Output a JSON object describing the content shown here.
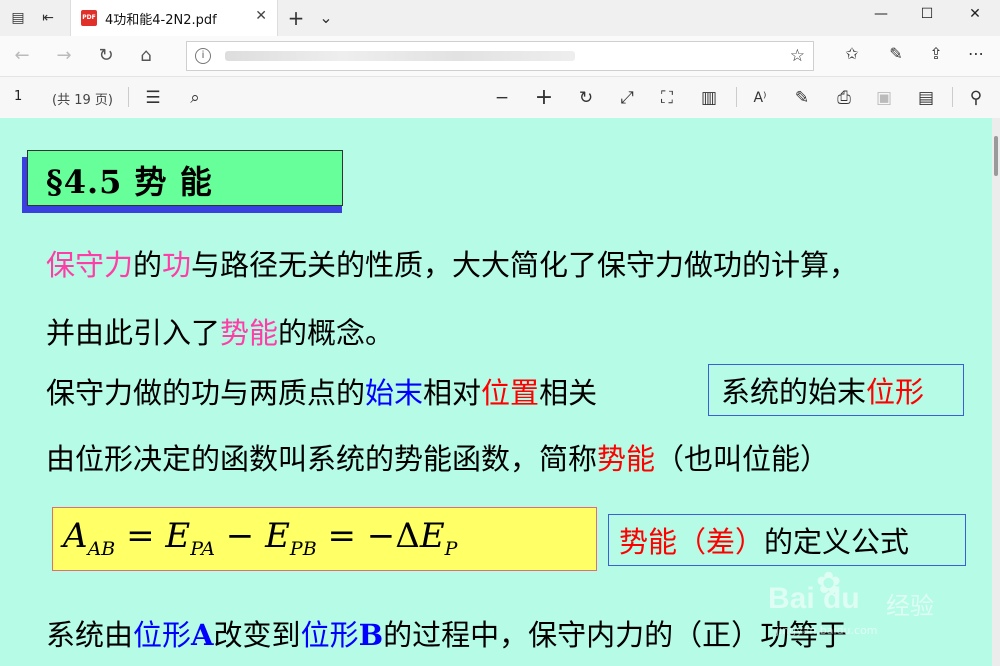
{
  "tab": {
    "title": "4功和能4-2N2.pdf",
    "pdf_badge": "PDF",
    "close": "✕"
  },
  "tabbar": {
    "new_tab": "+",
    "list": "⌄",
    "minimize": "—",
    "maximize": "☐",
    "close": "✕"
  },
  "address": {
    "url": "",
    "info": "i"
  },
  "pdf_toolbar": {
    "page_number": "1",
    "page_count": "(共 19 页)"
  },
  "doc": {
    "title": "§4.5  势 能",
    "para1": {
      "a": "保守力",
      "b": "的",
      "c": "功",
      "d": "与路径无关的性质，大大简化了保守力做功的计算，"
    },
    "para2": {
      "a": "并由此引入了",
      "b": "势能",
      "c": "的概念。"
    },
    "para3": {
      "a": "保守力做的功与两质点的",
      "b": "始末",
      "c": "相对",
      "d": "位置",
      "e": "相关"
    },
    "box1": {
      "a": "系统的始末",
      "b": "位形"
    },
    "para4": {
      "a": "由位形决定的函数叫系统的势能函数，简称",
      "b": "势能",
      "c": "（也叫位能）"
    },
    "formula": {
      "A": "A",
      "AB": "AB",
      "eq": "=",
      "E1": "E",
      "PA": "PA",
      "minus": "−",
      "E2": "E",
      "PB": "PB",
      "eq2": "= −Δ",
      "E3": "E",
      "P": "P"
    },
    "box2": {
      "a": "势能（差）",
      "b": "的定义公式"
    },
    "para5": {
      "a": "系统由",
      "b": "位形",
      "c": "A",
      "d": "改变到",
      "e": "位形",
      "f": "B",
      "g": "的过程中，保守内力的（正）功等于"
    }
  },
  "watermark": {
    "brand": "Bai du",
    "cn": "经验",
    "url": "jingyan.baidu.com"
  },
  "colors": {
    "background": "#b6fbe6",
    "title_box": "#66ff9a",
    "formula_box": "#ffff66",
    "pink": "#ff3da6",
    "red": "#ff0000",
    "blue": "#0000ff"
  }
}
